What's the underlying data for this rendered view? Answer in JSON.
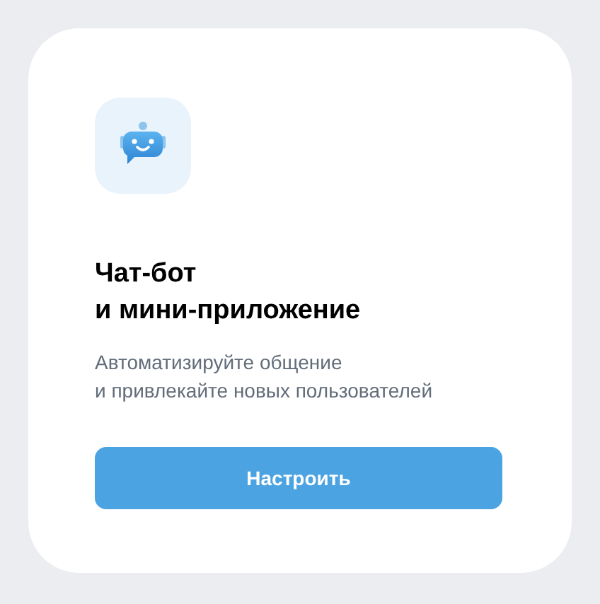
{
  "card": {
    "title": "Чат-бот\nи мини-приложение",
    "description": "Автоматизируйте общение\nи привлекайте новых пользователей",
    "button": "Настроить"
  }
}
